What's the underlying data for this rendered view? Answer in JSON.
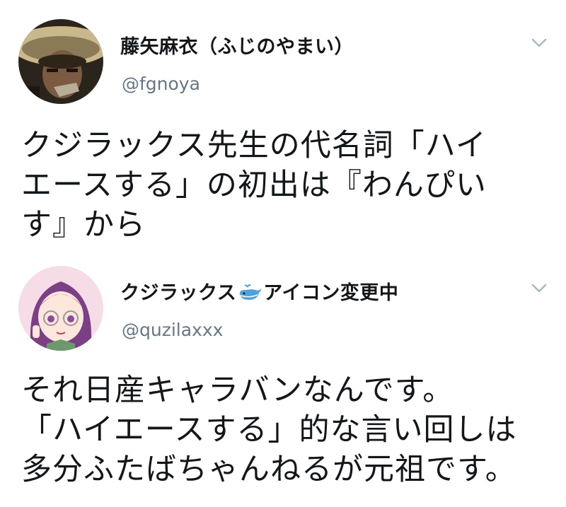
{
  "tweets": [
    {
      "display_name": "藤矢麻衣（ふじのやまい）",
      "handle": "@fgnoya",
      "avatar_icon": "user-avatar-photo",
      "menu_icon": "chevron-down-icon",
      "text_lines": [
        "クジラックス先生の代名詞「ハイ",
        "エースする」の初出は『わんぴい",
        "す』から"
      ]
    },
    {
      "display_name_prefix": "クジラックス",
      "display_name_emoji": "whale-emoji",
      "display_name_suffix": "アイコン変更中",
      "handle": "@quzilaxxx",
      "avatar_icon": "anime-girl-avatar",
      "menu_icon": "chevron-down-icon",
      "text_lines": [
        "それ日産キャラバンなんです。",
        "「ハイエースする」的な言い回しは",
        "多分ふたばちゃんねるが元祖です。"
      ]
    }
  ],
  "colors": {
    "text": "#14171a",
    "secondary": "#657786",
    "chevron": "#aab8c2",
    "whale": "#4da3e0"
  }
}
